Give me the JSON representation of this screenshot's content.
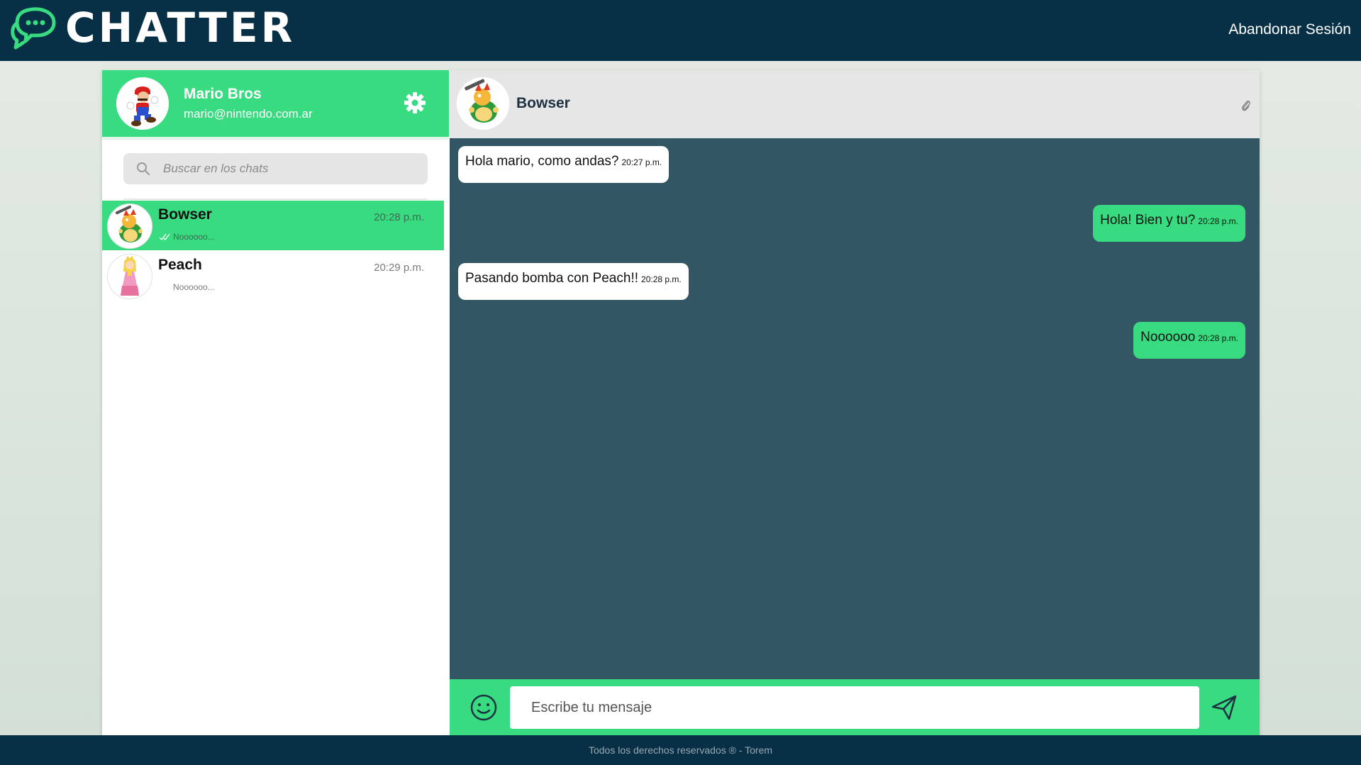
{
  "topbar": {
    "logo_text": "CHATTER",
    "logout_label": "Abandonar Sesión"
  },
  "profile": {
    "name": "Mario Bros",
    "email": "mario@nintendo.com.ar",
    "settings_icon": "gear-icon"
  },
  "search": {
    "placeholder": "Buscar en los chats",
    "icon": "search-icon"
  },
  "chats": [
    {
      "name": "Bowser",
      "time": "20:28 p.m.",
      "preview": "Noooooo...",
      "active": true,
      "read_icon": "double-check-icon"
    },
    {
      "name": "Peach",
      "time": "20:29 p.m.",
      "preview": "Noooooo...",
      "active": false
    }
  ],
  "conversation": {
    "contact_name": "Bowser",
    "attach_icon": "paperclip-icon",
    "messages": [
      {
        "direction": "in",
        "text": "Hola mario, como andas?",
        "time": "20:27 p.m."
      },
      {
        "direction": "out",
        "text": "Hola! Bien y tu?",
        "time": "20:28 p.m."
      },
      {
        "direction": "in",
        "text": "Pasando bomba con Peach!!",
        "time": "20:28 p.m."
      },
      {
        "direction": "out",
        "text": "Noooooo",
        "time": "20:28 p.m."
      }
    ]
  },
  "composer": {
    "placeholder": "Escribe tu mensaje",
    "emoji_icon": "emoji-icon",
    "send_icon": "send-icon"
  },
  "footer": {
    "text": "Todos los derechos reservados ® - Torem"
  },
  "colors": {
    "accent_green": "#38db80",
    "dark_navy": "#072f46",
    "chat_bg": "#335664"
  }
}
